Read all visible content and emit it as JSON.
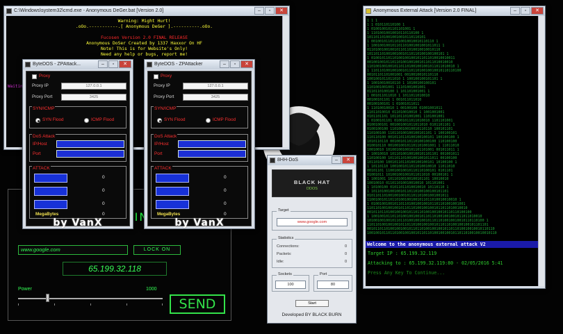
{
  "cmd": {
    "title": "C:\\Windows\\system32\\cmd.exe - Anonymous DeGer.bat [Version 2.0]",
    "lines": [
      "Warning: Might Hurt!",
      ".oOo.-----------.[ Anonymous DeGer ].----------.oOo.",
      "",
      "Fucosen Version 2.0 FINAL RELEASE",
      "Anonymous DoSer Created by 1337 Haxxor On HF",
      "Note! This is for Website's Only!",
      "Need any help or bugs, report me!"
    ],
    "side_label": "Waiting"
  },
  "matrix": {
    "title": "Anonymous External Attack [Version 2.0 FINAL]",
    "welcome": "Welcome to the anonymous external attack V2",
    "target": "Target IP : 65.199.32.119",
    "attacking": "Attacking to : 65.199.32.119:80 - 02/05/2016 5:41",
    "press": "Press Any Key To Continue..."
  },
  "bytedos_left": {
    "title": "ByteDOS - ZPAttack...",
    "proxy_label": "Proxy",
    "proxy_ip_label": "Proxy IP",
    "proxy_ip_value": "127.0.0.1",
    "proxy_port_label": "Proxy Port",
    "proxy_port_value": "3425",
    "syn_group": "SYN/ICMP",
    "syn_flood": "SYN Flood",
    "icmp_flood": "ICMP Flood",
    "dos_group": "DoS Attack",
    "ip_host_label": "IP/Host",
    "port_label": "Port",
    "attack_group": "ATTACK",
    "counters": [
      "0",
      "0",
      "0",
      "0"
    ],
    "megabytes_label": "MegaBytes",
    "signature": "by VanX"
  },
  "bytedos_right": {
    "title": "ByteDOS - ZPAttacker",
    "proxy_label": "Proxy",
    "proxy_ip_label": "Proxy IP",
    "proxy_ip_value": "127.0.0.1",
    "proxy_port_label": "Proxy Port",
    "proxy_port_value": "3425",
    "syn_group": "SYN/ICMP",
    "syn_flood": "SYN Flood",
    "icmp_flood": "ICMP Flood",
    "dos_group": "DoS Attack",
    "ip_host_label": "IP/Host",
    "port_label": "Port",
    "attack_group": "ATTACK",
    "counters": [
      "0",
      "0",
      "0",
      "0"
    ],
    "megabytes_label": "MegaBytes",
    "signature": "by VanX"
  },
  "ping": {
    "banner": "PING ATTACK",
    "url_value": "www.google.com",
    "lock_on_label": "LOCK ON",
    "ip_display": "65.199.32.118",
    "power_label": "Power",
    "power_max": "1000",
    "power_level": 0.2,
    "send_label": "SEND"
  },
  "bhdos": {
    "title": "8HH-DoS",
    "banner_title": "BLACK HAT",
    "banner_sub": "DDOS",
    "target_group": "Target",
    "target_value": "www.google.com",
    "stats_group": "Statistics",
    "connections_label": "Connections:",
    "connections_value": "0",
    "packets_label": "Packets:",
    "packets_value": "0",
    "idle_label": "Idle:",
    "idle_value": "0",
    "sockets_group": "Sockets",
    "sockets_value": "100",
    "port_group": "Port",
    "port_value": "80",
    "start_label": "Start",
    "developed_by": "Developed BY BLACK BURN"
  },
  "colors": {
    "terminal_yellow": "#ffff3a",
    "matrix_green": "#2fd02f",
    "bytedos_blue": "#1b2fd6",
    "ping_green": "#33e34a"
  }
}
